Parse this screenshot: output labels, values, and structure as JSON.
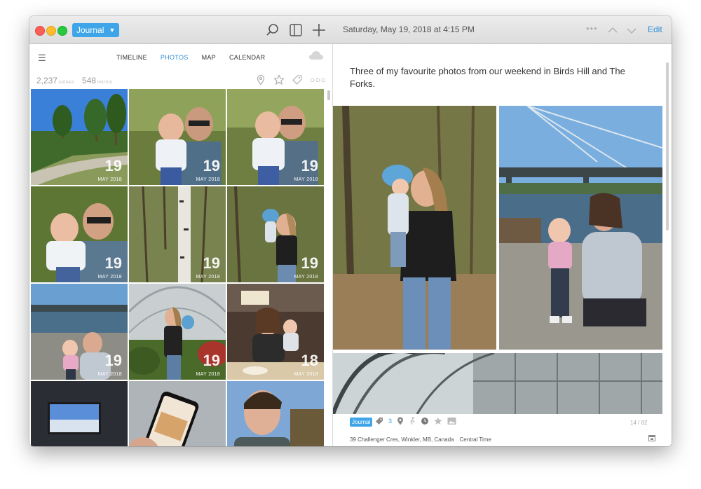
{
  "titlebar": {
    "journal_label": "Journal",
    "date_text": "Saturday, May 19, 2018 at 4:15 PM",
    "edit_label": "Edit"
  },
  "left": {
    "tabs": [
      {
        "label": "TIMELINE"
      },
      {
        "label": "PHOTOS"
      },
      {
        "label": "MAP"
      },
      {
        "label": "CALENDAR"
      }
    ],
    "entries_count": "2,237",
    "entries_label": "ENTRIES",
    "photos_count": "548",
    "photos_label": "PHOTOS",
    "photos": [
      {
        "day": "19",
        "month": "MAY 2018"
      },
      {
        "day": "19",
        "month": "MAY 2018"
      },
      {
        "day": "19",
        "month": "MAY 2018"
      },
      {
        "day": "19",
        "month": "MAY 2018"
      },
      {
        "day": "19",
        "month": "MAY 2018"
      },
      {
        "day": "19",
        "month": "MAY 2018"
      },
      {
        "day": "19",
        "month": "MAY 2018"
      },
      {
        "day": "19",
        "month": "MAY 2018"
      },
      {
        "day": "18",
        "month": "MAY 2018"
      }
    ]
  },
  "entry": {
    "text": "Three of my favourite photos from our weekend in Birds Hill and The Forks.",
    "journal_tag": "Journal",
    "tag_count": "3",
    "page": "14  /  82",
    "location": "39 Challenger Cres, Winkler, MB, Canada",
    "timezone": "Central Time"
  }
}
